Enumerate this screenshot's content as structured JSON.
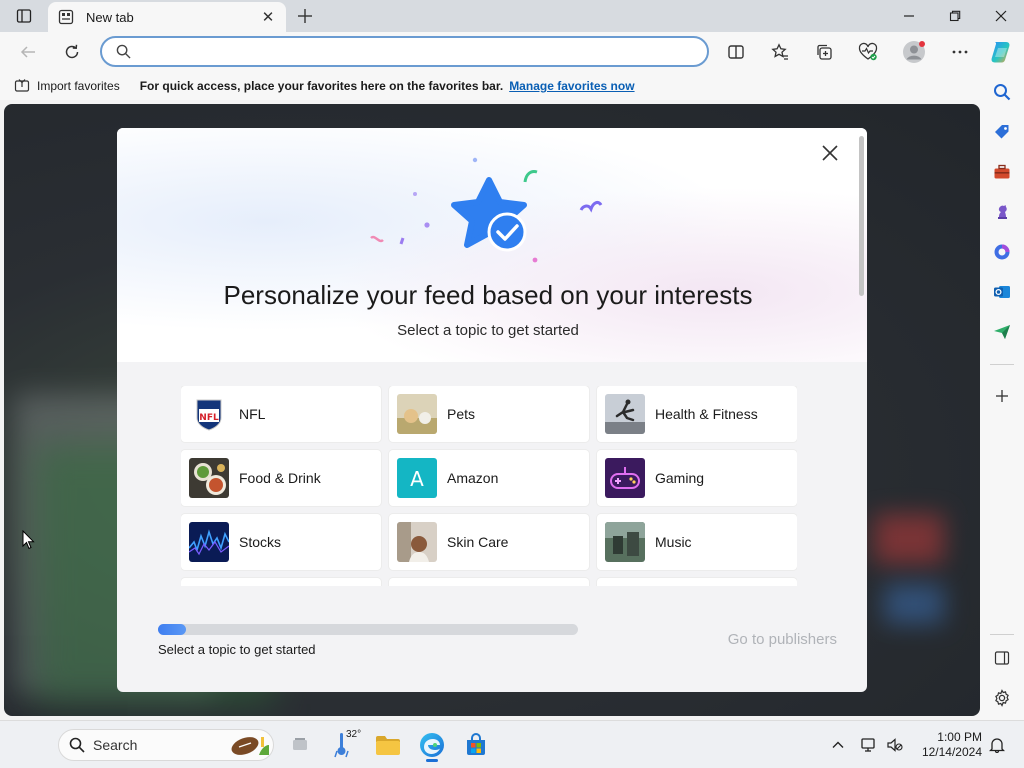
{
  "browser": {
    "tab": {
      "title": "New tab"
    },
    "address": {
      "placeholder": ""
    }
  },
  "favorites_bar": {
    "import_label": "Import favorites",
    "hint": "For quick access, place your favorites here on the favorites bar.",
    "manage_link": "Manage favorites now"
  },
  "modal": {
    "title": "Personalize your feed based on your interests",
    "subtitle": "Select a topic to get started",
    "topics": [
      {
        "label": "NFL"
      },
      {
        "label": "Pets"
      },
      {
        "label": "Health & Fitness"
      },
      {
        "label": "Food & Drink"
      },
      {
        "label": "Amazon"
      },
      {
        "label": "Gaming"
      },
      {
        "label": "Stocks"
      },
      {
        "label": "Skin Care"
      },
      {
        "label": "Music"
      }
    ],
    "progress": {
      "fraction": 0.03,
      "label": "Select a topic to get started"
    },
    "go_button": "Go to publishers"
  },
  "taskbar": {
    "search_label": "Search",
    "weather": "32°",
    "time": "1:00 PM",
    "date": "12/14/2024"
  },
  "colors": {
    "accent": "#0a5fb4",
    "progress": "#3f7ef0",
    "amazon_tile": "#14b6c4"
  }
}
